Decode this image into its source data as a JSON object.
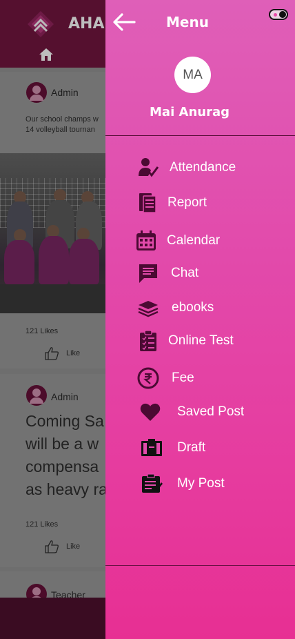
{
  "app": {
    "title": "AHA",
    "icons": {
      "logo": "aha-logo",
      "home": "home-icon"
    },
    "posts": [
      {
        "author": "Admin",
        "text": "Our school champs w\n14  volleyball tournan",
        "likes": "121 Likes",
        "like_label": "Like"
      },
      {
        "author": "Admin",
        "text": "Coming Sa\nwill be a w\ncompensa\nas heavy ra",
        "likes": "121 Likes",
        "like_label": "Like"
      },
      {
        "author": "Teacher"
      }
    ]
  },
  "drawer": {
    "title": "Menu",
    "back_icon": "arrow-left-icon",
    "theme_toggle_icon": "toggle-icon",
    "profile": {
      "initials": "MA",
      "name": "Mai Anurag"
    },
    "items": [
      {
        "label": "Attendance",
        "icon": "attendance-icon"
      },
      {
        "label": "Report",
        "icon": "report-icon"
      },
      {
        "label": "Calendar",
        "icon": "calendar-icon"
      },
      {
        "label": "Chat",
        "icon": "chat-icon"
      },
      {
        "label": "ebooks",
        "icon": "books-icon"
      },
      {
        "label": "Online Test",
        "icon": "clipboard-icon"
      },
      {
        "label": "Fee",
        "icon": "rupee-icon"
      },
      {
        "label": "Saved Post",
        "icon": "heart-icon"
      },
      {
        "label": "Draft",
        "icon": "draft-icon"
      },
      {
        "label": "My Post",
        "icon": "my-post-icon"
      }
    ],
    "colors": {
      "gradient_top": "#df5fb8",
      "gradient_bottom": "#e72f93",
      "icon": "#4b0a33"
    }
  }
}
